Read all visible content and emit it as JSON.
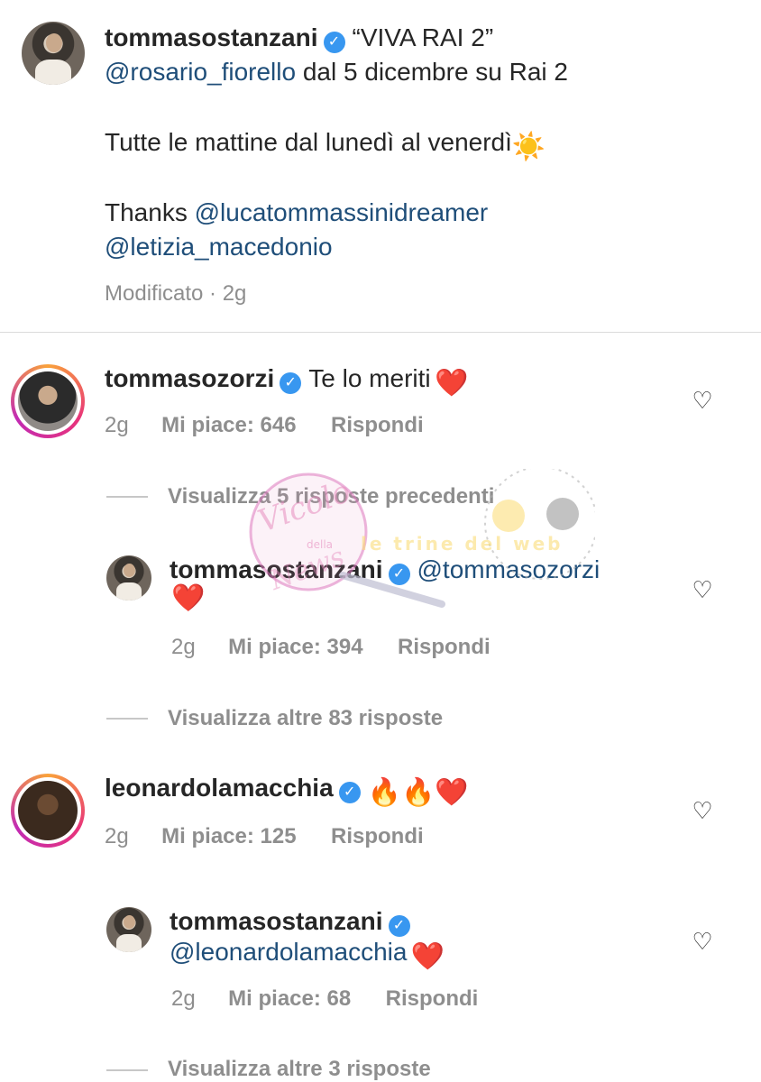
{
  "caption": {
    "username": "tommasostanzani",
    "line1_text": "“VIVA RAI 2”",
    "line2_mention": "@rosario_fiorello",
    "line2_text": " dal 5 dicembre su Rai 2",
    "line3_text": "Tutte le mattine dal lunedì al venerdì",
    "line3_emoji": "☀️",
    "line4_text": "Thanks ",
    "line4_mention": "@lucatommassinidreamer",
    "line5_mention": "@letizia_macedonio",
    "meta": "Modificato · 2g"
  },
  "comments": [
    {
      "username": "tommasozorzi",
      "text": "Te lo meriti",
      "emoji": "❤️",
      "time": "2g",
      "likes": "Mi piace: 646",
      "reply": "Rispondi",
      "view_replies": "Visualizza 5 risposte precedenti"
    },
    {
      "username": "tommasostanzani",
      "mention": "@tommasozorzi",
      "emoji": "❤️",
      "time": "2g",
      "likes": "Mi piace: 394",
      "reply": "Rispondi",
      "view_replies": "Visualizza altre 83 risposte"
    },
    {
      "username": "leonardolamacchia",
      "emoji": "🔥🔥❤️",
      "time": "2g",
      "likes": "Mi piace: 125",
      "reply": "Rispondi"
    },
    {
      "username": "tommasostanzani",
      "mention": "@leonardolamacchia",
      "emoji": "❤️",
      "time": "2g",
      "likes": "Mi piace: 68",
      "reply": "Rispondi",
      "view_replies": "Visualizza altre 3 risposte"
    }
  ],
  "icons": {
    "verified": "verified-badge-icon",
    "heart": "heart-outline-icon"
  },
  "watermark": {
    "script_text": "Vicolo",
    "small_text": "della",
    "script_text2": "News",
    "brand_text": "le trine del web"
  },
  "colors": {
    "link": "#1f4e79",
    "verified": "#3897f0",
    "meta": "#8e8e8e"
  }
}
